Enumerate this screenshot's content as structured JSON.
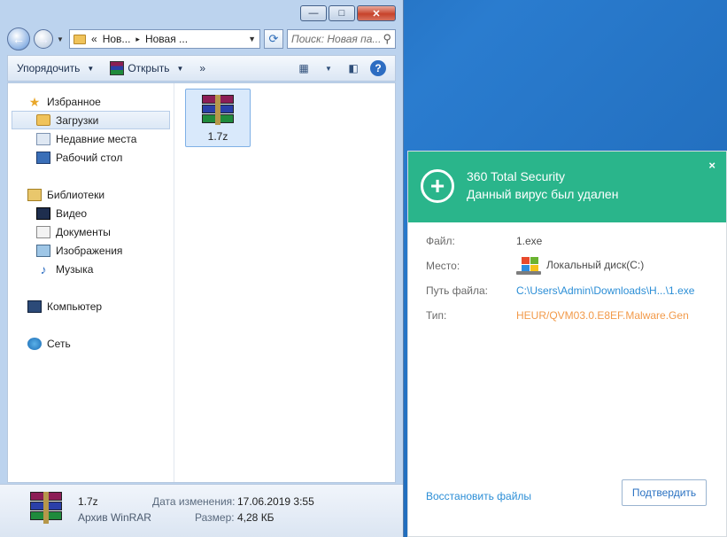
{
  "explorer": {
    "window_buttons": {
      "minimize": "—",
      "maximize": "□",
      "close": "✕"
    },
    "breadcrumb": {
      "chevron": "«",
      "part1": "Нов...",
      "sep": "▸",
      "part2": "Новая ..."
    },
    "search_placeholder": "Поиск: Новая па...",
    "toolbar": {
      "organize": "Упорядочить",
      "open": "Открыть",
      "more": "»"
    },
    "nav": {
      "favorites": "Избранное",
      "downloads": "Загрузки",
      "recent": "Недавние места",
      "desktop": "Рабочий стол",
      "libraries": "Библиотеки",
      "video": "Видео",
      "documents": "Документы",
      "pictures": "Изображения",
      "music": "Музыка",
      "computer": "Компьютер",
      "network": "Сеть"
    },
    "file": {
      "name": "1.7z"
    },
    "details": {
      "name": "1.7z",
      "type": "Архив WinRAR",
      "modified_label": "Дата изменения:",
      "modified_value": "17.06.2019 3:55",
      "size_label": "Размер:",
      "size_value": "4,28 КБ"
    }
  },
  "popup": {
    "title": "360 Total Security",
    "subtitle": "Данный вирус был удален",
    "close": "×",
    "rows": {
      "file_label": "Файл:",
      "file_value": "1.exe",
      "location_label": "Место:",
      "location_value": "Локальный диск(C:)",
      "path_label": "Путь файла:",
      "path_value": "C:\\Users\\Admin\\Downloads\\H...\\1.exe",
      "type_label": "Тип:",
      "type_value": "HEUR/QVM03.0.E8EF.Malware.Gen"
    },
    "restore_link": "Восстановить файлы",
    "confirm_button": "Подтвердить"
  },
  "colors": {
    "popup_header": "#2ab58b",
    "link": "#2b8ed6",
    "warning": "#f29a4a",
    "desktop": "#1b63b0"
  },
  "icons": [
    "back-arrow-icon",
    "forward-arrow-icon",
    "folder-icon",
    "refresh-icon",
    "search-icon",
    "winrar-icon",
    "view-icon",
    "preview-pane-icon",
    "help-icon",
    "star-icon",
    "windows-drive-icon",
    "plus-icon",
    "close-icon"
  ]
}
